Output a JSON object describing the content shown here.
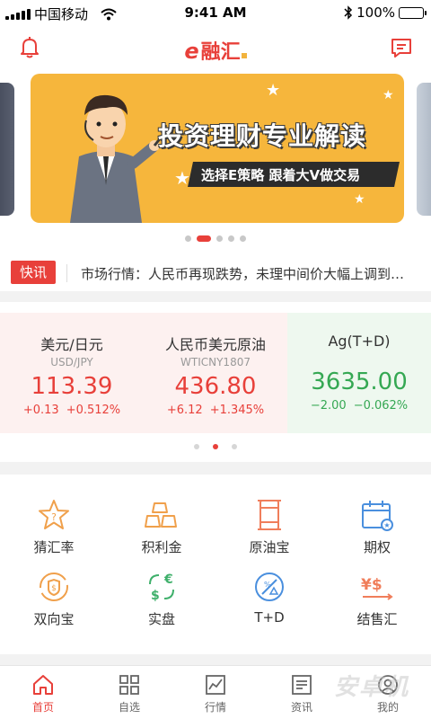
{
  "status_bar": {
    "carrier": "中国移动",
    "time": "9:41 AM",
    "battery": "100%"
  },
  "header": {
    "logo_text": "融汇",
    "logo_mark": "e"
  },
  "banner": {
    "title": "投资理财专业解读",
    "subtitle": "选择E策略 跟着大V做交易",
    "page_count": 5,
    "active_index": 1
  },
  "news": {
    "tag": "快讯",
    "text": "市场行情：人民币再现跌势，未理中间价大幅上调到…"
  },
  "quotes": [
    {
      "name": "美元/日元",
      "code": "USD/JPY",
      "price": "113.39",
      "change": "+0.13",
      "percent": "+0.512%",
      "trend": "up"
    },
    {
      "name": "人民币美元原油",
      "code": "WTICNY1807",
      "price": "436.80",
      "change": "+6.12",
      "percent": "+1.345%",
      "trend": "up"
    },
    {
      "name": "Ag(T+D)",
      "code": "",
      "price": "3635.00",
      "change": "−2.00",
      "percent": "−0.062%",
      "trend": "down"
    }
  ],
  "quote_pages": 3,
  "quote_active_page": 1,
  "features": [
    {
      "label": "猜汇率",
      "icon": "star-question-icon"
    },
    {
      "label": "积利金",
      "icon": "gold-bars-icon"
    },
    {
      "label": "原油宝",
      "icon": "oil-barrel-icon"
    },
    {
      "label": "期权",
      "icon": "calendar-icon"
    },
    {
      "label": "双向宝",
      "icon": "two-way-coin-icon"
    },
    {
      "label": "实盘",
      "icon": "currency-exchange-icon"
    },
    {
      "label": "T+D",
      "icon": "percent-badge-icon"
    },
    {
      "label": "结售汇",
      "icon": "yen-dollar-icon"
    }
  ],
  "tabs": [
    {
      "label": "首页",
      "icon": "home-icon",
      "active": true
    },
    {
      "label": "自选",
      "icon": "grid-icon",
      "active": false
    },
    {
      "label": "行情",
      "icon": "chart-icon",
      "active": false
    },
    {
      "label": "资讯",
      "icon": "news-icon",
      "active": false
    },
    {
      "label": "我的",
      "icon": "profile-icon",
      "active": false
    }
  ],
  "watermark": "安卓机",
  "colors": {
    "accent": "#e8403a",
    "up": "#e8403a",
    "down": "#35a853",
    "banner_bg": "#f6b63c",
    "icon_orange": "#f0a04b",
    "icon_green": "#3fb06b",
    "icon_blue": "#4a8fde"
  }
}
